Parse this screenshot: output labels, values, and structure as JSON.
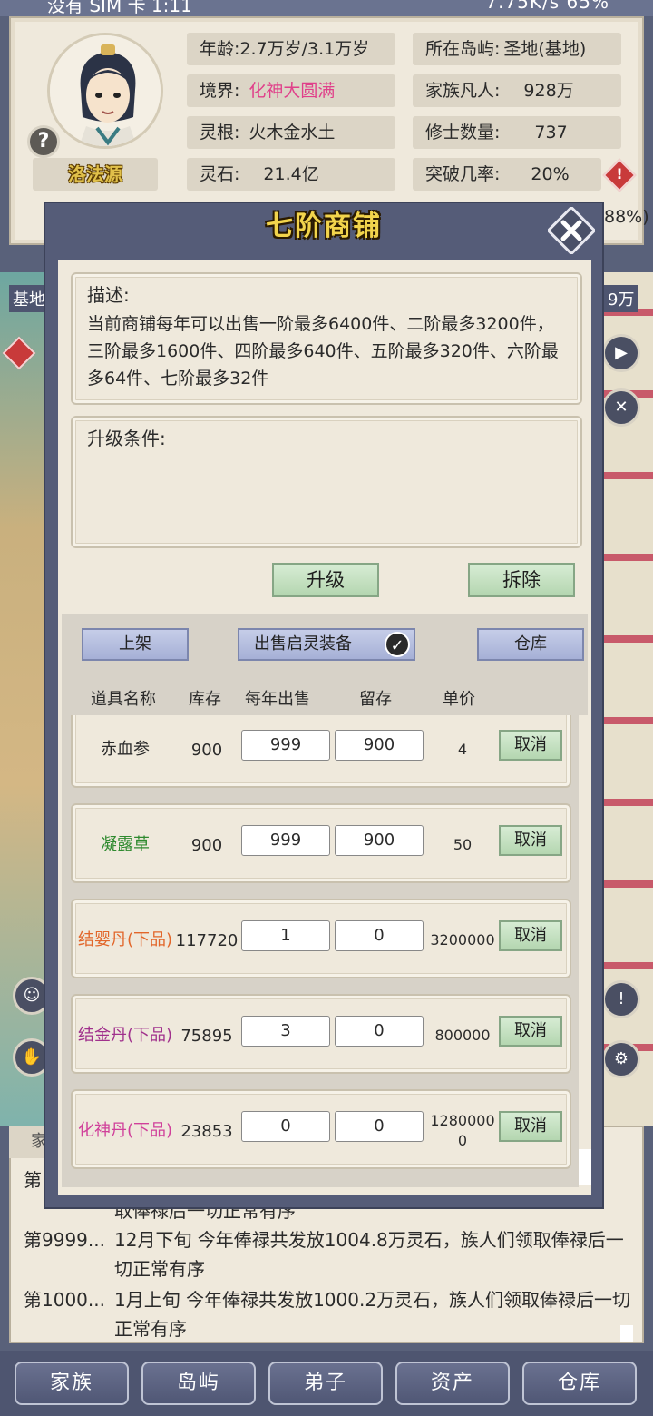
{
  "status_bar": {
    "left": "没有 SIM 卡 1:11",
    "right": "7.75K/s  65%"
  },
  "character": {
    "name": "洛法源",
    "help_symbol": "?",
    "age_label": "年龄:",
    "age_value": "2.7万岁/3.1万岁",
    "island_label": "所在岛屿:",
    "island_value": "圣地(基地)",
    "realm_label": "境界:",
    "realm_value": "化神大圆满",
    "mortals_label": "家族凡人:",
    "mortals_value": "928万",
    "root_label": "灵根:",
    "root_value": "火木金水土",
    "cultivators_label": "修士数量:",
    "cultivators_value": "737",
    "stones_label": "灵石:",
    "stones_value": "21.4亿",
    "breakthrough_label": "突破几率:",
    "breakthrough_value": "20%",
    "breakthrough_tail": "88%)"
  },
  "map": {
    "base_label": "基地",
    "right_label": "9万"
  },
  "shop": {
    "title": "七阶商铺",
    "desc_label": "描述:",
    "desc_text": "当前商铺每年可以出售一阶最多6400件、二阶最多3200件，三阶最多1600件、四阶最多640件、五阶最多320件、六阶最多64件、七阶最多32件",
    "upgrade_cond_label": "升级条件:",
    "upgrade_button": "升级",
    "demolish_button": "拆除",
    "list_button": "上架",
    "sell_equip_button": "出售启灵装备",
    "warehouse_button": "仓库",
    "columns": [
      "道具名称",
      "库存",
      "每年出售",
      "留存",
      "单价"
    ],
    "cancel_label": "取消",
    "items": [
      {
        "name": "赤血参",
        "stock": "900",
        "sell": "999",
        "keep": "900",
        "price": "4",
        "color": "#2b2b2b"
      },
      {
        "name": "凝露草",
        "stock": "900",
        "sell": "999",
        "keep": "900",
        "price": "50",
        "color": "#2f8a2f"
      },
      {
        "name": "结婴丹(下品)",
        "stock": "117720",
        "sell": "1",
        "keep": "0",
        "price": "3200000",
        "color": "#e2662a"
      },
      {
        "name": "结金丹(下品)",
        "stock": "75895",
        "sell": "3",
        "keep": "0",
        "price": "800000",
        "color": "#a0308c"
      },
      {
        "name": "化神丹(下品)",
        "stock": "23853",
        "sell": "0",
        "keep": "0",
        "price": "12800000",
        "color": "#d0409a"
      }
    ]
  },
  "log": {
    "tab": "家",
    "first_prefix": "第",
    "partial_line": "取俸禄后一切正常有序",
    "entries": [
      {
        "id": "第9999...",
        "text": "12月下旬 今年俸禄共发放1004.8万灵石，族人们领取俸禄后一切正常有序"
      },
      {
        "id": "第1000...",
        "text": "1月上旬 今年俸禄共发放1000.2万灵石，族人们领取俸禄后一切正常有序"
      }
    ]
  },
  "nav": [
    "家族",
    "岛屿",
    "弟子",
    "资产",
    "仓库"
  ],
  "colors": {
    "accent_title": "#f2d44c",
    "realm_pink": "#e0408a",
    "panel_bg": "#efe9dc",
    "modal_frame": "#555c78"
  }
}
